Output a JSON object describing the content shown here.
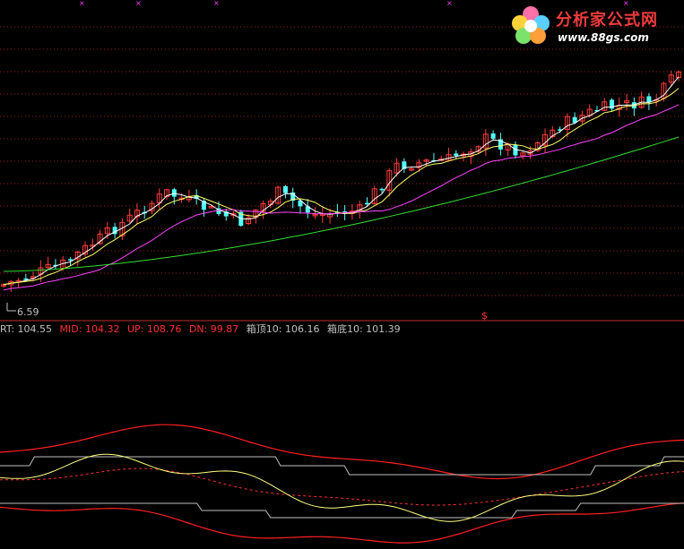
{
  "logo": {
    "text": "分析家公式网",
    "url": "www.88gs.com"
  },
  "main_panel": {
    "min_label": "6.59",
    "marker_glyph": "$"
  },
  "indicator_bar": {
    "items": [
      {
        "label": "RT: 104.55",
        "color": "#c0c0c0"
      },
      {
        "label": "MID: 104.32",
        "color": "#ff3030"
      },
      {
        "label": "UP: 108.76",
        "color": "#ff3030"
      },
      {
        "label": "DN: 99.87",
        "color": "#ff3030"
      },
      {
        "label": "箱顶10: 106.16",
        "color": "#c0c0c0"
      },
      {
        "label": "箱底10: 101.39",
        "color": "#c0c0c0"
      }
    ]
  },
  "colors": {
    "up_candle": "#ff3c3c",
    "down_candle": "#54ffff",
    "ma_short": "#ffffff",
    "ma_mid": "#ffff66",
    "ma_long": "#ff44ff",
    "ma_longer": "#33dd33",
    "band_outer": "#ff2020",
    "band_mid": "#ff3030",
    "box_line": "#c0c0c0",
    "rt_line": "#ffff80",
    "grid": "#a02020"
  },
  "chart_data": {
    "type": "candlestick",
    "series_count": 92,
    "min_marker": 6.59,
    "indicator": {
      "RT": 104.55,
      "MID": 104.32,
      "UP": 108.76,
      "DN": 99.87,
      "box_top_10": 106.16,
      "box_bottom_10": 101.39
    }
  }
}
